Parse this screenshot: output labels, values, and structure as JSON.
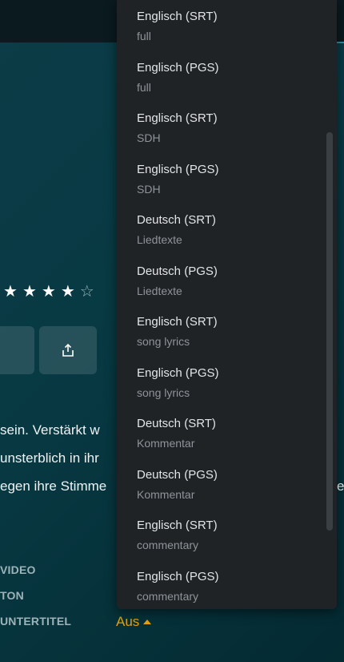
{
  "rating": {
    "stars_filled": 4,
    "stars_total": 5
  },
  "description_lines": [
    "sein. Verstärkt w",
    "unsterblich in ihr",
    "egen ihre Stimme",
    "e"
  ],
  "meta": {
    "video_label": "VIDEO",
    "audio_label": "TON",
    "subtitles_label": "UNTERTITEL",
    "subtitles_value": "Aus"
  },
  "icons": {
    "share": "share-icon",
    "star": "star-icon",
    "caret": "caret-up-icon"
  },
  "colors": {
    "accent": "#e5a00d",
    "dropdown_bg": "#1f2326"
  },
  "subtitle_options": [
    {
      "name": "Englisch (SRT)",
      "sub": "full"
    },
    {
      "name": "Englisch (PGS)",
      "sub": "full"
    },
    {
      "name": "Englisch (SRT)",
      "sub": "SDH"
    },
    {
      "name": "Englisch (PGS)",
      "sub": "SDH"
    },
    {
      "name": "Deutsch (SRT)",
      "sub": "Liedtexte"
    },
    {
      "name": "Deutsch (PGS)",
      "sub": "Liedtexte"
    },
    {
      "name": "Englisch (SRT)",
      "sub": "song lyrics"
    },
    {
      "name": "Englisch (PGS)",
      "sub": "song lyrics"
    },
    {
      "name": "Deutsch (SRT)",
      "sub": "Kommentar"
    },
    {
      "name": "Deutsch (PGS)",
      "sub": "Kommentar"
    },
    {
      "name": "Englisch (SRT)",
      "sub": "commentary"
    },
    {
      "name": "Englisch (PGS)",
      "sub": "commentary"
    }
  ]
}
